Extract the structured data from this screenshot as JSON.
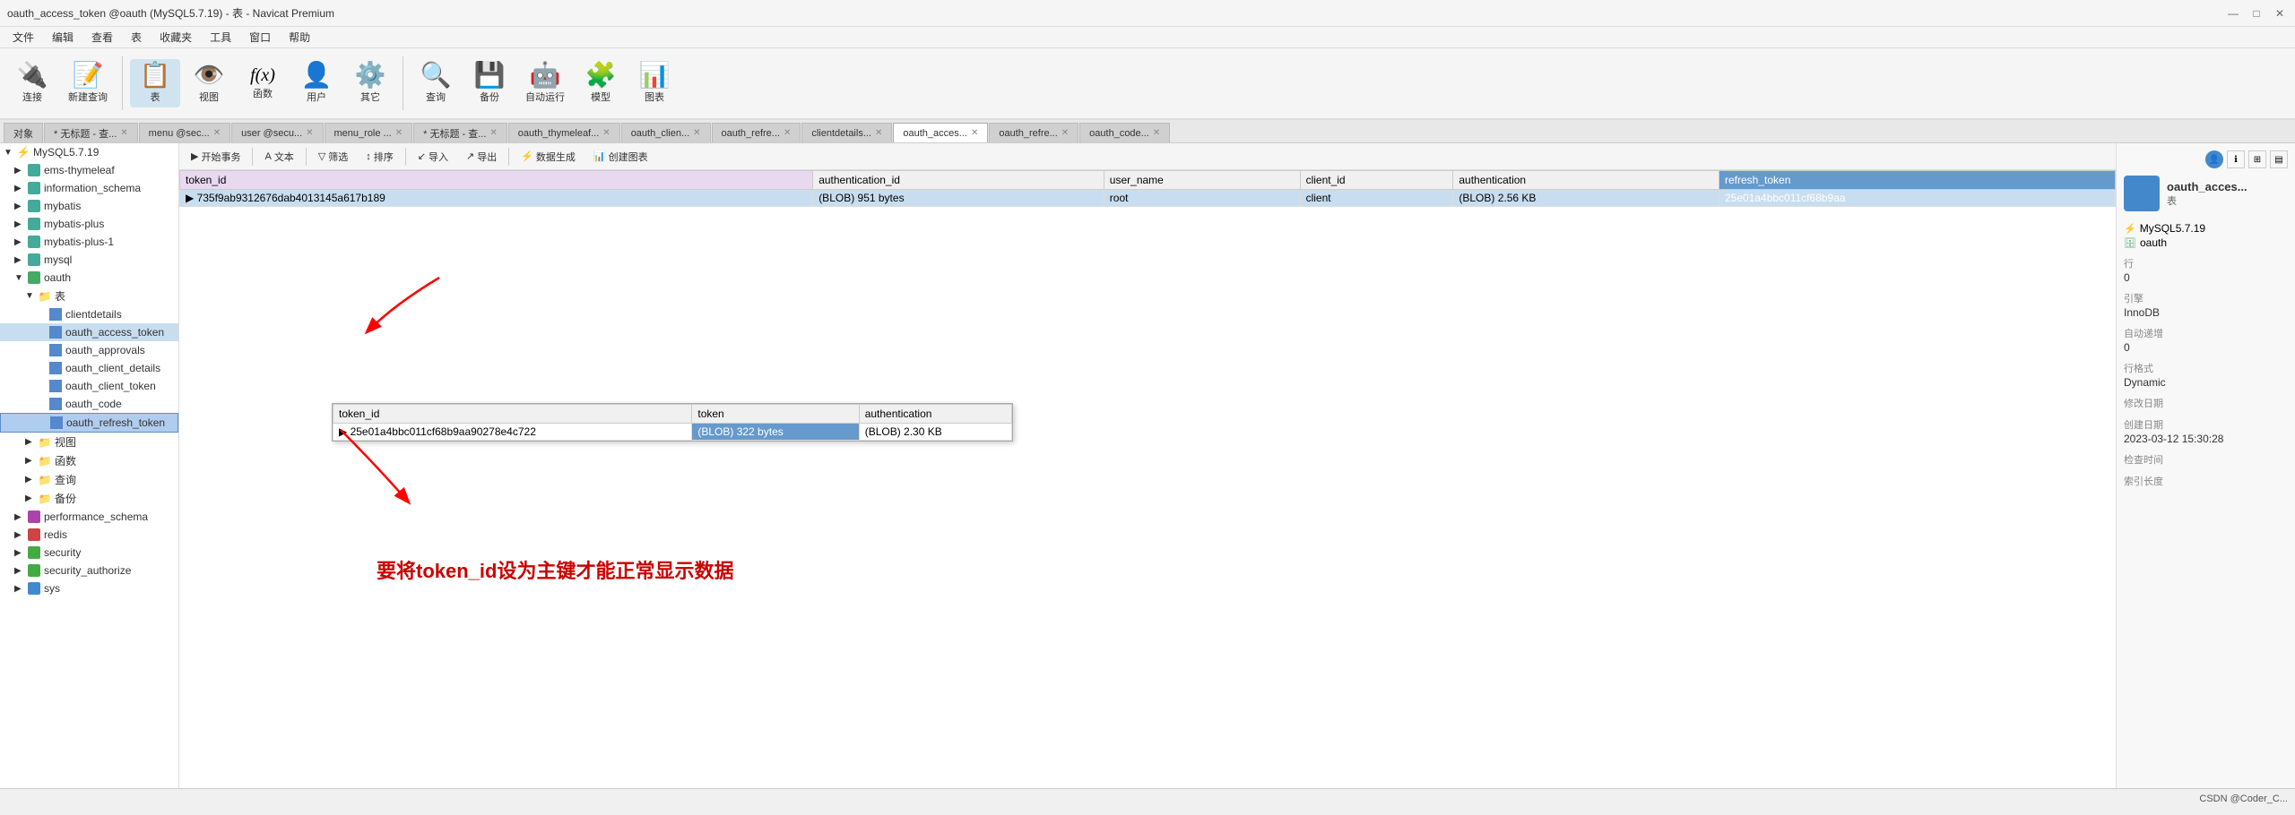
{
  "window": {
    "title": "oauth_access_token @oauth (MySQL5.7.19) - 表 - Navicat Premium",
    "controls": [
      "minimize",
      "maximize",
      "close"
    ]
  },
  "menubar": {
    "items": [
      "文件",
      "编辑",
      "查看",
      "表",
      "收藏夹",
      "工具",
      "窗口",
      "帮助"
    ]
  },
  "toolbar": {
    "groups": [
      {
        "id": "connect",
        "icon": "🔌",
        "label": "连接"
      },
      {
        "id": "new-query",
        "icon": "📝",
        "label": "新建查询"
      },
      {
        "id": "table",
        "icon": "📋",
        "label": "表",
        "active": true
      },
      {
        "id": "view",
        "icon": "👁️",
        "label": "视图"
      },
      {
        "id": "function",
        "icon": "fx",
        "label": "函数"
      },
      {
        "id": "user",
        "icon": "👤",
        "label": "用户"
      },
      {
        "id": "other",
        "icon": "⚙️",
        "label": "其它"
      },
      {
        "id": "query",
        "icon": "🔍",
        "label": "查询"
      },
      {
        "id": "backup",
        "icon": "💾",
        "label": "备份"
      },
      {
        "id": "auto-run",
        "icon": "🤖",
        "label": "自动运行"
      },
      {
        "id": "model",
        "icon": "🧩",
        "label": "模型"
      },
      {
        "id": "chart",
        "icon": "📊",
        "label": "图表"
      }
    ]
  },
  "tabs": [
    {
      "id": "target",
      "label": "对象",
      "active": false
    },
    {
      "id": "untitled1",
      "label": "* 无标题 - 查...",
      "active": false
    },
    {
      "id": "menu-sec",
      "label": "menu @sec...",
      "active": false
    },
    {
      "id": "user-sec",
      "label": "user @secu...",
      "active": false
    },
    {
      "id": "menu-role",
      "label": "menu_role ...",
      "active": false
    },
    {
      "id": "untitled2",
      "label": "* 无标题 - 查...",
      "active": false
    },
    {
      "id": "oauth-thymeleaf",
      "label": "oauth_thymeleaf...",
      "active": false
    },
    {
      "id": "oauth-client",
      "label": "oauth_clien...",
      "active": false
    },
    {
      "id": "oauth-refresh",
      "label": "oauth_refre...",
      "active": false
    },
    {
      "id": "clientdetails",
      "label": "clientdetails...",
      "active": false
    },
    {
      "id": "oauth-access",
      "label": "oauth_acces...",
      "active": true
    },
    {
      "id": "oauth-refresh2",
      "label": "oauth_refre...",
      "active": false
    },
    {
      "id": "oauth-code",
      "label": "oauth_code...",
      "active": false
    }
  ],
  "actionbar": {
    "buttons": [
      {
        "id": "start",
        "label": "开始事务"
      },
      {
        "id": "text",
        "label": "文本"
      },
      {
        "id": "filter",
        "label": "筛选"
      },
      {
        "id": "sort",
        "label": "排序"
      },
      {
        "id": "import",
        "label": "导入"
      },
      {
        "id": "export",
        "label": "导出"
      },
      {
        "id": "generate",
        "label": "数据生成"
      },
      {
        "id": "create-chart",
        "label": "创建图表"
      }
    ]
  },
  "sidebar": {
    "items": [
      {
        "id": "mysql",
        "label": "MySQL5.7.19",
        "type": "server",
        "level": 0,
        "expanded": true
      },
      {
        "id": "ems-thymeleaf",
        "label": "ems-thymeleaf",
        "type": "db",
        "level": 1
      },
      {
        "id": "information-schema",
        "label": "information_schema",
        "type": "db",
        "level": 1
      },
      {
        "id": "mybatis",
        "label": "mybatis",
        "type": "db",
        "level": 1
      },
      {
        "id": "mybatis-plus",
        "label": "mybatis-plus",
        "type": "db",
        "level": 1
      },
      {
        "id": "mybatis-plus-1",
        "label": "mybatis-plus-1",
        "type": "db",
        "level": 1
      },
      {
        "id": "mysql-db",
        "label": "mysql",
        "type": "db",
        "level": 1
      },
      {
        "id": "oauth",
        "label": "oauth",
        "type": "db",
        "level": 1,
        "expanded": true
      },
      {
        "id": "tables-folder",
        "label": "表",
        "type": "folder",
        "level": 2,
        "expanded": true
      },
      {
        "id": "clientdetails",
        "label": "clientdetails",
        "type": "table",
        "level": 3
      },
      {
        "id": "oauth-access-token",
        "label": "oauth_access_token",
        "type": "table",
        "level": 3,
        "selected": true
      },
      {
        "id": "oauth-approvals",
        "label": "oauth_approvals",
        "type": "table",
        "level": 3
      },
      {
        "id": "oauth-client-details",
        "label": "oauth_client_details",
        "type": "table",
        "level": 3
      },
      {
        "id": "oauth-client-token",
        "label": "oauth_client_token",
        "type": "table",
        "level": 3
      },
      {
        "id": "oauth-code",
        "label": "oauth_code",
        "type": "table",
        "level": 3
      },
      {
        "id": "oauth-refresh-token",
        "label": "oauth_refresh_token",
        "type": "table",
        "level": 3,
        "highlighted": true
      },
      {
        "id": "views-folder",
        "label": "视图",
        "type": "folder",
        "level": 2
      },
      {
        "id": "funcs-folder",
        "label": "函数",
        "type": "folder",
        "level": 2
      },
      {
        "id": "queries-folder",
        "label": "查询",
        "type": "folder",
        "level": 2
      },
      {
        "id": "backups-folder",
        "label": "备份",
        "type": "folder",
        "level": 2
      },
      {
        "id": "performance-schema",
        "label": "performance_schema",
        "type": "db",
        "level": 1
      },
      {
        "id": "redis",
        "label": "redis",
        "type": "db",
        "level": 1
      },
      {
        "id": "security",
        "label": "security",
        "type": "db",
        "level": 1
      },
      {
        "id": "security-authorize",
        "label": "security_authorize",
        "type": "db",
        "level": 1
      },
      {
        "id": "sys",
        "label": "sys",
        "type": "db",
        "level": 1
      }
    ]
  },
  "main_table": {
    "columns": [
      "token_id",
      "authentication_id",
      "user_name",
      "client_id",
      "authentication",
      "refresh_token"
    ],
    "rows": [
      {
        "token_id": "735f9ab9312676dab4013145a617b189",
        "authentication_id": "(BLOB) 951 bytes",
        "user_name": "root",
        "client_id": "client",
        "authentication": "(BLOB) 2.56 KB",
        "refresh_token": "25e01a4bbc011cf68b9aa"
      }
    ]
  },
  "popup_table": {
    "columns": [
      "token_id",
      "token",
      "authentication"
    ],
    "rows": [
      {
        "token_id": "25e01a4bbc011cf68b9aa90278e4c722",
        "token": "(BLOB) 322 bytes",
        "authentication": "(BLOB) 2.30 KB"
      }
    ]
  },
  "annotation_text": "要将token_id设为主键才能正常显示数据",
  "right_panel": {
    "title": "oauth_acces...",
    "subtitle": "表",
    "db_label": "MySQL5.7.19",
    "schema_label": "oauth",
    "rows_label": "行",
    "rows_value": "0",
    "engine_label": "引擎",
    "engine_value": "InnoDB",
    "auto_inc_label": "自动递增",
    "auto_inc_value": "0",
    "format_label": "行格式",
    "format_value": "Dynamic",
    "modified_label": "修改日期",
    "modified_value": "",
    "created_label": "创建日期",
    "created_value": "2023-03-12 15:30:28",
    "check_label": "检查时间",
    "check_value": "",
    "comment_label": "索引长度",
    "comment_value": ""
  },
  "statusbar": {
    "text": "CSDN @Coder_C..."
  }
}
